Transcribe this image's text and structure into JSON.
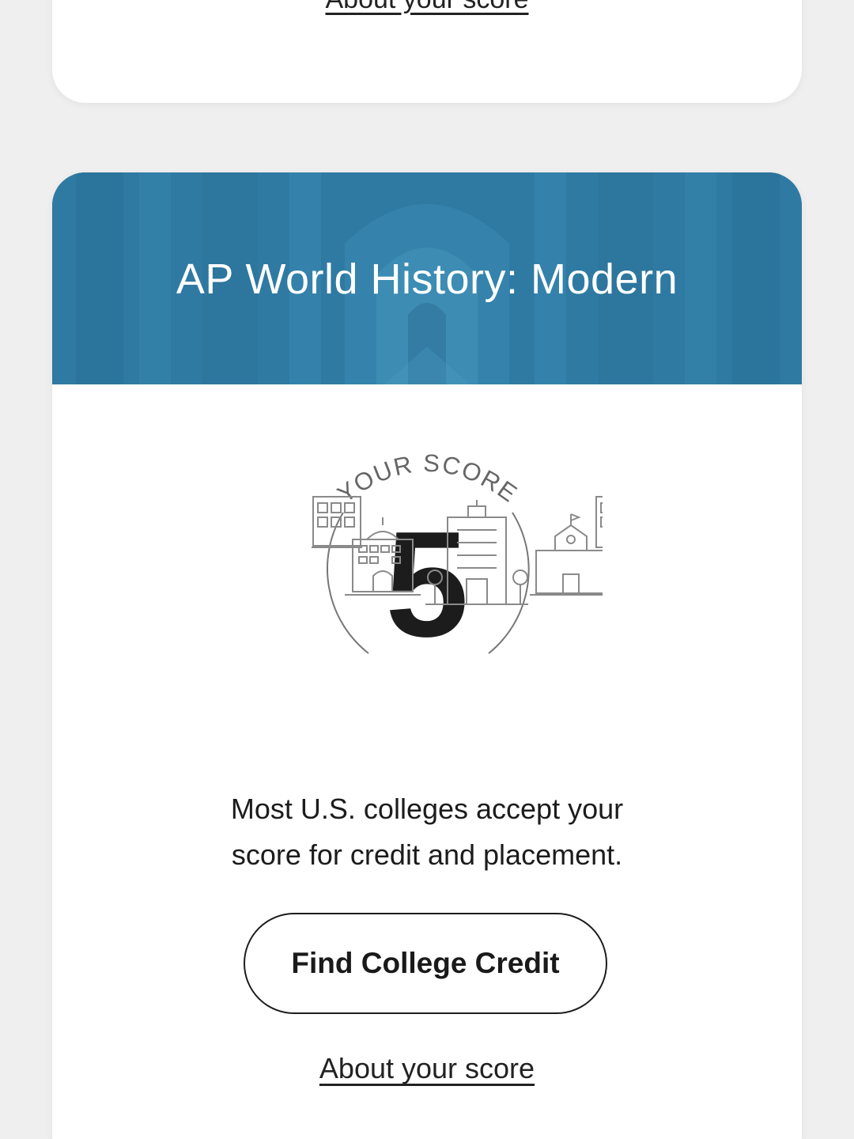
{
  "previous_card": {
    "about_link": "About your score"
  },
  "card": {
    "title": "AP World History: Modern",
    "score_arc_label": "YOUR SCORE",
    "score_value": "5",
    "caption_line1": "Most U.S. colleges accept your",
    "caption_line2": "score for credit and placement.",
    "cta_button": "Find College Credit",
    "about_link": "About your score"
  },
  "colors": {
    "header_bg": "#2f7aa3",
    "page_bg": "#efefef",
    "card_bg": "#ffffff",
    "text": "#1c1c1c"
  },
  "icons": [
    "college-buildings-illustration",
    "score-arc-icon"
  ]
}
